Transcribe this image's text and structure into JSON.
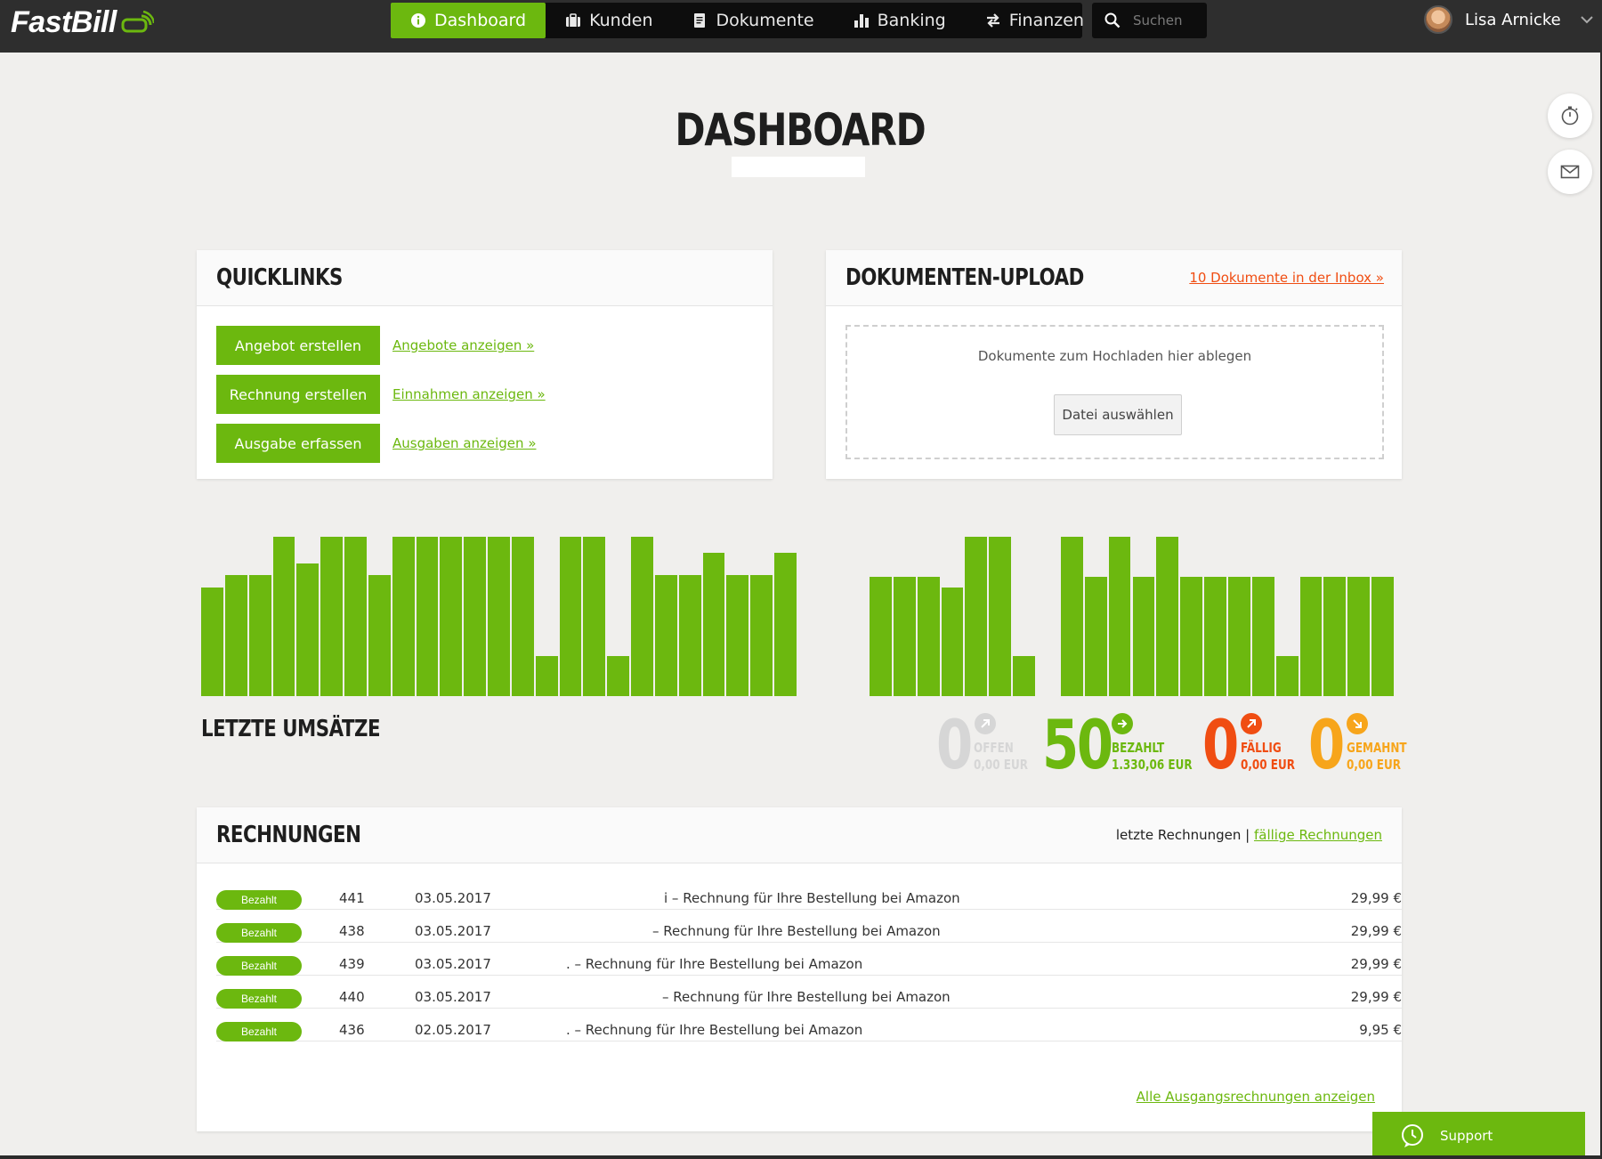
{
  "app": {
    "logo_text": "FastBill",
    "accent_color": "#6cb80f"
  },
  "nav": {
    "items": [
      {
        "label": "Dashboard",
        "icon": "info-icon",
        "active": true
      },
      {
        "label": "Kunden",
        "icon": "briefcase-icon",
        "active": false
      },
      {
        "label": "Dokumente",
        "icon": "document-icon",
        "active": false
      },
      {
        "label": "Banking",
        "icon": "bar-chart-icon",
        "active": false
      },
      {
        "label": "Finanzen",
        "icon": "transfer-arrows-icon",
        "active": false
      }
    ],
    "search_placeholder": "Suchen",
    "user_name": "Lisa Arnicke"
  },
  "page": {
    "title": "DASHBOARD"
  },
  "quicklinks": {
    "title": "QUICKLINKS",
    "rows": [
      {
        "button": "Angebot erstellen",
        "link": "Angebote anzeigen »"
      },
      {
        "button": "Rechnung erstellen",
        "link": "Einnahmen anzeigen »"
      },
      {
        "button": "Ausgabe erfassen",
        "link": "Ausgaben anzeigen »"
      }
    ]
  },
  "upload": {
    "title": "DOKUMENTEN-UPLOAD",
    "inbox_link": "10 Dokumente in der Inbox »",
    "drop_text": "Dokumente zum Hochladen hier ablegen",
    "choose_button": "Datei auswählen"
  },
  "chart_data": {
    "type": "bar",
    "title": "LETZTE UMSÄTZE",
    "series": [
      {
        "values": [
          0.68,
          0.76,
          0.76,
          1.0,
          0.83,
          1.0,
          1.0,
          0.76,
          1.0,
          1.0,
          1.0,
          1.0,
          1.0,
          1.0,
          0.25,
          1.0,
          1.0,
          0.25,
          1.0,
          0.76,
          0.76,
          0.9,
          0.76,
          0.76,
          0.9
        ]
      },
      {
        "values": [
          0.75,
          0.75,
          0.75,
          0.68,
          1.0,
          1.0,
          0.25,
          null,
          1.0,
          0.75,
          1.0,
          0.75,
          1.0,
          0.75,
          0.75,
          0.75,
          0.75,
          0.25,
          0.75,
          0.75,
          0.75,
          0.75
        ]
      }
    ]
  },
  "stats": {
    "offen": {
      "count": "0",
      "label": "OFFEN",
      "amount": "0,00 EUR",
      "color": "#d6d6d6"
    },
    "bezahlt": {
      "count": "50",
      "label": "BEZAHLT",
      "amount": "1.330,06 EUR",
      "color": "#6cb80f"
    },
    "faellig": {
      "count": "0",
      "label": "FÄLLIG",
      "amount": "0,00 EUR",
      "color": "#f04d12"
    },
    "gemahnt": {
      "count": "0",
      "label": "GEMAHNT",
      "amount": "0,00 EUR",
      "color": "#f7a51b"
    }
  },
  "rechnungen": {
    "title": "RECHNUNGEN",
    "filter_current": "letzte Rechnungen",
    "filter_separator": " | ",
    "filter_link": "fällige Rechnungen",
    "rows": [
      {
        "status": "Bezahlt",
        "number": "441",
        "date": "03.05.2017",
        "description": "i – Rechnung für Ihre Bestellung bei Amazon",
        "amount": "29,99 €"
      },
      {
        "status": "Bezahlt",
        "number": "438",
        "date": "03.05.2017",
        "description": "– Rechnung für Ihre Bestellung bei Amazon",
        "amount": "29,99 €"
      },
      {
        "status": "Bezahlt",
        "number": "439",
        "date": "03.05.2017",
        "description": ". – Rechnung für Ihre Bestellung bei Amazon",
        "amount": "29,99 €"
      },
      {
        "status": "Bezahlt",
        "number": "440",
        "date": "03.05.2017",
        "description": "– Rechnung für Ihre Bestellung bei Amazon",
        "amount": "29,99 €"
      },
      {
        "status": "Bezahlt",
        "number": "436",
        "date": "02.05.2017",
        "description": ". – Rechnung für Ihre Bestellung bei Amazon",
        "amount": "9,95 €"
      }
    ],
    "all_link": "Alle Ausgangsrechnungen anzeigen"
  },
  "support": {
    "label": "Support"
  }
}
